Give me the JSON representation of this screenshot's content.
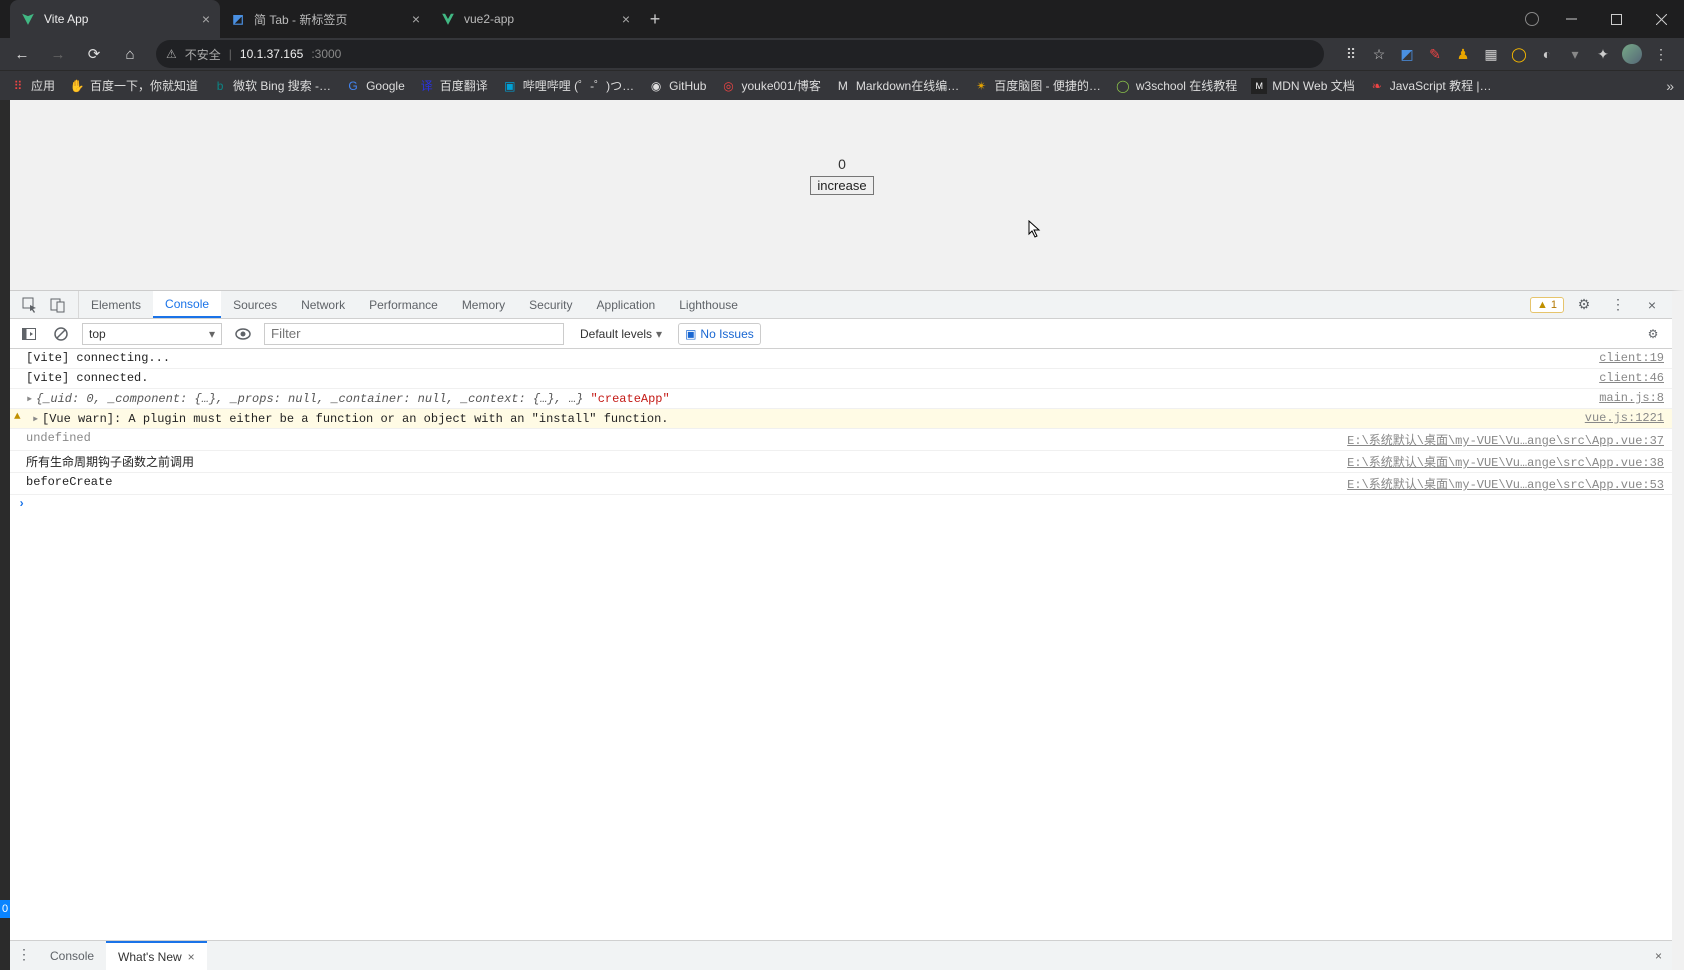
{
  "browser_tabs": [
    {
      "title": "Vite App",
      "active": true
    },
    {
      "title": "简 Tab - 新标签页",
      "active": false
    },
    {
      "title": "vue2-app",
      "active": false
    }
  ],
  "url": {
    "security_label": "不安全",
    "host": "10.1.37.165",
    "port": ":3000"
  },
  "bookmarks": {
    "apps": "应用",
    "items": [
      "百度一下，你就知道",
      "微软 Bing 搜索 -…",
      "Google",
      "百度翻译",
      "哔哩哔哩 (゜-゜)つ…",
      "GitHub",
      "youke001/博客",
      "Markdown在线编…",
      "百度脑图 - 便捷的…",
      "w3school 在线教程",
      "MDN Web 文档",
      "JavaScript 教程 |…"
    ]
  },
  "page": {
    "counter": "0",
    "button": "increase"
  },
  "devtools": {
    "panels": [
      "Elements",
      "Console",
      "Sources",
      "Network",
      "Performance",
      "Memory",
      "Security",
      "Application",
      "Lighthouse"
    ],
    "active_panel": "Console",
    "warn_count": "1",
    "console": {
      "context": "top",
      "filter_placeholder": "Filter",
      "levels": "Default levels",
      "issues": "No Issues"
    },
    "logs": [
      {
        "type": "log",
        "msg": "[vite] connecting...",
        "src": "client:19"
      },
      {
        "type": "log",
        "msg": "[vite] connected.",
        "src": "client:46"
      },
      {
        "type": "obj",
        "msg_pre": "{_uid: 0, _component: {…}, _props: null, _container: null, _context: {…}, …}",
        "msg_str": "\"createApp\"",
        "src": "main.js:8"
      },
      {
        "type": "warn",
        "msg": "[Vue warn]: A plugin must either be a function or an object with an \"install\" function.",
        "src": "vue.js:1221"
      },
      {
        "type": "log",
        "msg": "undefined",
        "src": "E:\\系统默认\\桌面\\my-VUE\\Vu…ange\\src\\App.vue:37"
      },
      {
        "type": "log",
        "msg": "所有生命周期钩子函数之前调用",
        "src": "E:\\系统默认\\桌面\\my-VUE\\Vu…ange\\src\\App.vue:38"
      },
      {
        "type": "log",
        "msg": "beforeCreate",
        "src": "E:\\系统默认\\桌面\\my-VUE\\Vu…ange\\src\\App.vue:53"
      }
    ],
    "drawer": {
      "tabs": [
        "Console",
        "What's New"
      ],
      "active": "What's New"
    }
  },
  "bl_mark": "0"
}
